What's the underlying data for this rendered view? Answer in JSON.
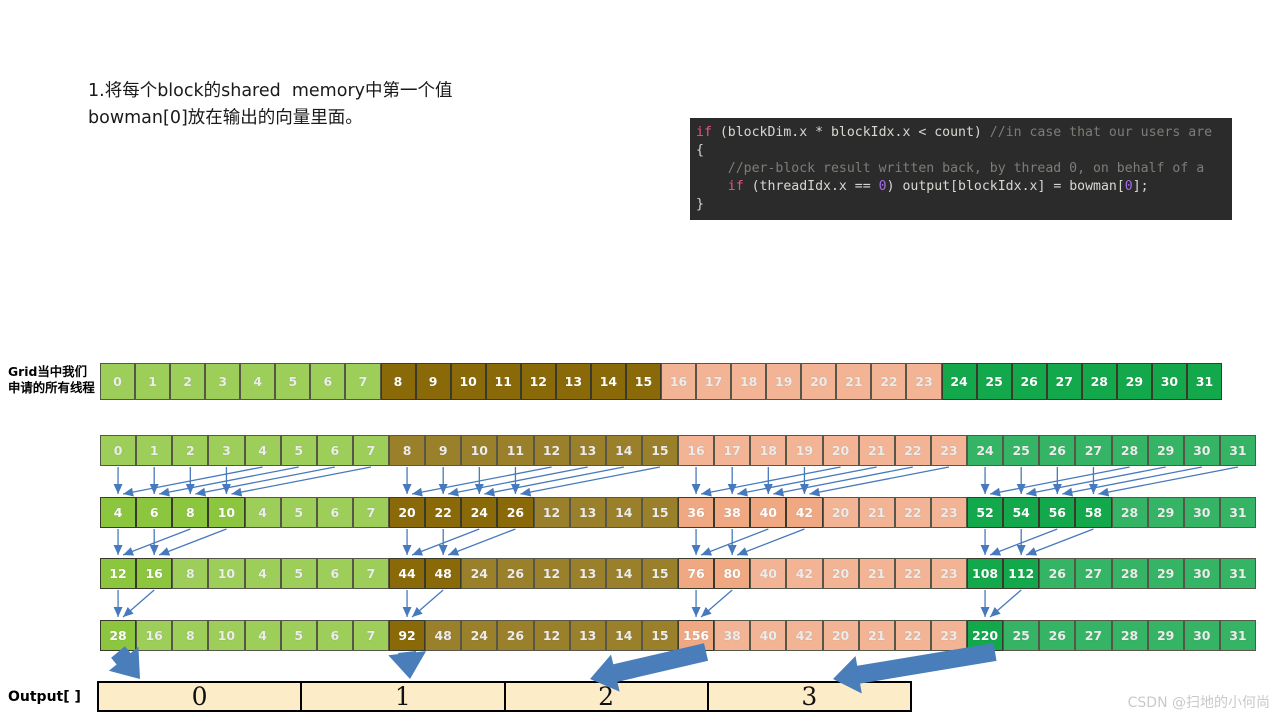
{
  "note": {
    "line1": "1.将每个block的shared  memory中第一个值",
    "line2": "bowman[0]放在输出的向量里面。"
  },
  "code": {
    "line1_kw": "if",
    "line1_cond": " (blockDim.x * blockIdx.x < count) ",
    "line1_comment": "//in case that our users are",
    "line2": "{",
    "line3_comment": "//per-block result written back, by thread 0, on behalf of a",
    "line4_kw": "if",
    "line4_a": " (threadIdx.x == ",
    "line4_num": "0",
    "line4_b": ") output[blockIdx.x] = bowman[",
    "line4_num2": "0",
    "line4_c": "];",
    "line5": "}"
  },
  "labels": {
    "grid": "Grid当中我们申请的所有线程",
    "output": "Output[ ]"
  },
  "colors": {
    "block0": "#8cc63e",
    "block1": "#8a6a08",
    "block2": "#f0a883",
    "block3": "#13a84b",
    "arrow": "#4779bd",
    "bigarrow": "#4a7ebb",
    "output_fill": "#fcedc8",
    "code_bg": "#2b2b2b"
  },
  "grid_row": {
    "name": "grid-thread-row",
    "values": [
      "0",
      "1",
      "2",
      "3",
      "4",
      "5",
      "6",
      "7",
      "8",
      "9",
      "10",
      "11",
      "12",
      "13",
      "14",
      "15",
      "16",
      "17",
      "18",
      "19",
      "20",
      "21",
      "22",
      "23",
      "24",
      "25",
      "26",
      "27",
      "28",
      "29",
      "30",
      "31"
    ],
    "dim": [
      true,
      true,
      true,
      true,
      true,
      true,
      true,
      true,
      false,
      false,
      false,
      false,
      false,
      false,
      false,
      false,
      true,
      true,
      true,
      true,
      true,
      true,
      true,
      true,
      false,
      false,
      false,
      false,
      false,
      false,
      false,
      false
    ]
  },
  "reduction_rows": [
    {
      "step": 0,
      "values": [
        "0",
        "1",
        "2",
        "3",
        "4",
        "5",
        "6",
        "7",
        "8",
        "9",
        "10",
        "11",
        "12",
        "13",
        "14",
        "15",
        "16",
        "17",
        "18",
        "19",
        "20",
        "21",
        "22",
        "23",
        "24",
        "25",
        "26",
        "27",
        "28",
        "29",
        "30",
        "31"
      ],
      "dim": [
        true,
        true,
        true,
        true,
        true,
        true,
        true,
        true,
        true,
        true,
        true,
        true,
        true,
        true,
        true,
        true,
        true,
        true,
        true,
        true,
        true,
        true,
        true,
        true,
        true,
        true,
        true,
        true,
        true,
        true,
        true,
        true
      ]
    },
    {
      "step": 1,
      "values": [
        "4",
        "6",
        "8",
        "10",
        "4",
        "5",
        "6",
        "7",
        "20",
        "22",
        "24",
        "26",
        "12",
        "13",
        "14",
        "15",
        "36",
        "38",
        "40",
        "42",
        "20",
        "21",
        "22",
        "23",
        "52",
        "54",
        "56",
        "58",
        "28",
        "29",
        "30",
        "31"
      ],
      "dim": [
        false,
        false,
        false,
        false,
        true,
        true,
        true,
        true,
        false,
        false,
        false,
        false,
        true,
        true,
        true,
        true,
        false,
        false,
        false,
        false,
        true,
        true,
        true,
        true,
        false,
        false,
        false,
        false,
        true,
        true,
        true,
        true
      ]
    },
    {
      "step": 2,
      "values": [
        "12",
        "16",
        "8",
        "10",
        "4",
        "5",
        "6",
        "7",
        "44",
        "48",
        "24",
        "26",
        "12",
        "13",
        "14",
        "15",
        "76",
        "80",
        "40",
        "42",
        "20",
        "21",
        "22",
        "23",
        "108",
        "112",
        "26",
        "27",
        "28",
        "29",
        "30",
        "31"
      ],
      "dim": [
        false,
        false,
        true,
        true,
        true,
        true,
        true,
        true,
        false,
        false,
        true,
        true,
        true,
        true,
        true,
        true,
        false,
        false,
        true,
        true,
        true,
        true,
        true,
        true,
        false,
        false,
        true,
        true,
        true,
        true,
        true,
        true
      ]
    },
    {
      "step": 3,
      "values": [
        "28",
        "16",
        "8",
        "10",
        "4",
        "5",
        "6",
        "7",
        "92",
        "48",
        "24",
        "26",
        "12",
        "13",
        "14",
        "15",
        "156",
        "38",
        "40",
        "42",
        "20",
        "21",
        "22",
        "23",
        "220",
        "25",
        "26",
        "27",
        "28",
        "29",
        "30",
        "31"
      ],
      "dim": [
        false,
        true,
        true,
        true,
        true,
        true,
        true,
        true,
        false,
        true,
        true,
        true,
        true,
        true,
        true,
        true,
        false,
        true,
        true,
        true,
        true,
        true,
        true,
        true,
        false,
        true,
        true,
        true,
        true,
        true,
        true,
        true
      ]
    }
  ],
  "output_cells": [
    "0",
    "1",
    "2",
    "3"
  ],
  "watermark": "CSDN @扫地的小何尚"
}
